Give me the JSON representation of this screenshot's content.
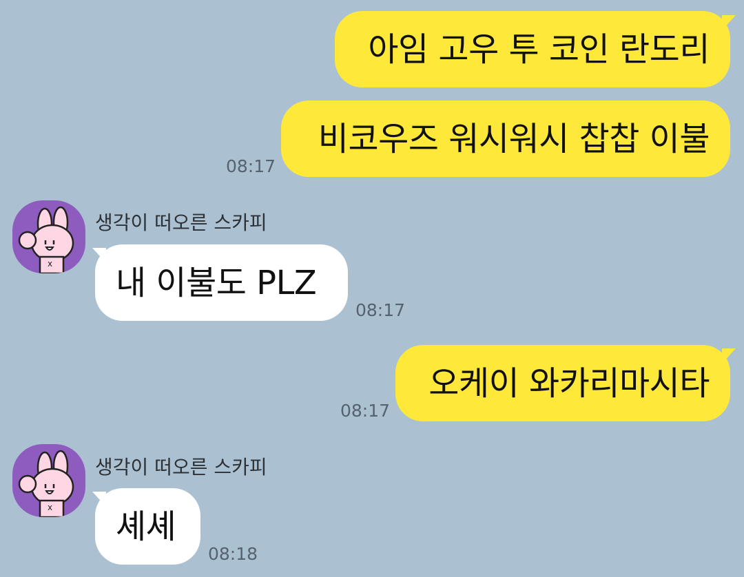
{
  "messages": [
    {
      "side": "me",
      "text": "아임 고우 투 코인 란도리"
    },
    {
      "side": "me",
      "text": "비코우즈 워시워시 찹찹 이불",
      "time": "08:17"
    },
    {
      "side": "them",
      "sender": "생각이 떠오른 스카피",
      "text": "내 이불도 PLZ",
      "time": "08:17"
    },
    {
      "side": "me",
      "text": "오케이 와카리마시타",
      "time": "08:17"
    },
    {
      "side": "them",
      "sender": "생각이 떠오른 스카피",
      "text": "셰셰",
      "time": "08:18"
    }
  ],
  "colors": {
    "background": "#abc1d1",
    "my_bubble": "#fee93a",
    "their_bubble": "#ffffff",
    "avatar_bg": "#8e5bbf"
  },
  "icons": {
    "avatar": "pink-rabbit-icon"
  }
}
